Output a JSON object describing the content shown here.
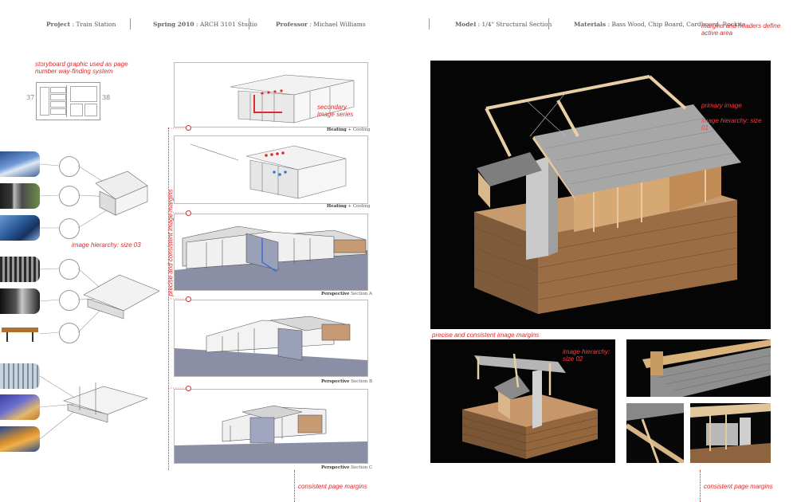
{
  "header": {
    "project_label": "Project",
    "project_value": "Train Station",
    "term_label": "Spring 2010",
    "term_value": "ARCH 3101 Studio",
    "professor_label": "Professor",
    "professor_value": "Michael Williams",
    "model_label": "Model",
    "model_value": "1/4\" Structural Section",
    "materials_label": "Materials",
    "materials_value": "Bass Wood, Chip Board, Cardboard, Rockite"
  },
  "annotations": {
    "storyboard": "storyboard graphic used as page number way-finding system",
    "margins_headers": "margins and headers define active area",
    "secondary": "secondary image series",
    "primary": "primary image",
    "hierarchy_1": "image hierarchy: size 01",
    "hierarchy_2": "image hierarchy: size 02",
    "hierarchy_3": "image hierarchy: size 03",
    "precise_vertical": "precise and consistent image margins",
    "precise_horizontal": "precise and consistent image margins",
    "consistent_left": "consistent page margins",
    "consistent_right": "consistent page margins"
  },
  "page_numbers": {
    "left": "37",
    "right": "38"
  },
  "captions": {
    "c1_bold": "Heating",
    "c1_rest": "+ Cooling",
    "c2_bold": "Heating",
    "c2_rest": "+ Cooling",
    "c3_bold": "Perspective",
    "c3_rest": "Section A",
    "c4_bold": "Perspective",
    "c4_rest": "Section B",
    "c5_bold": "Perspective",
    "c5_rest": "Section C"
  },
  "colors": {
    "accent": "#e3282a"
  }
}
